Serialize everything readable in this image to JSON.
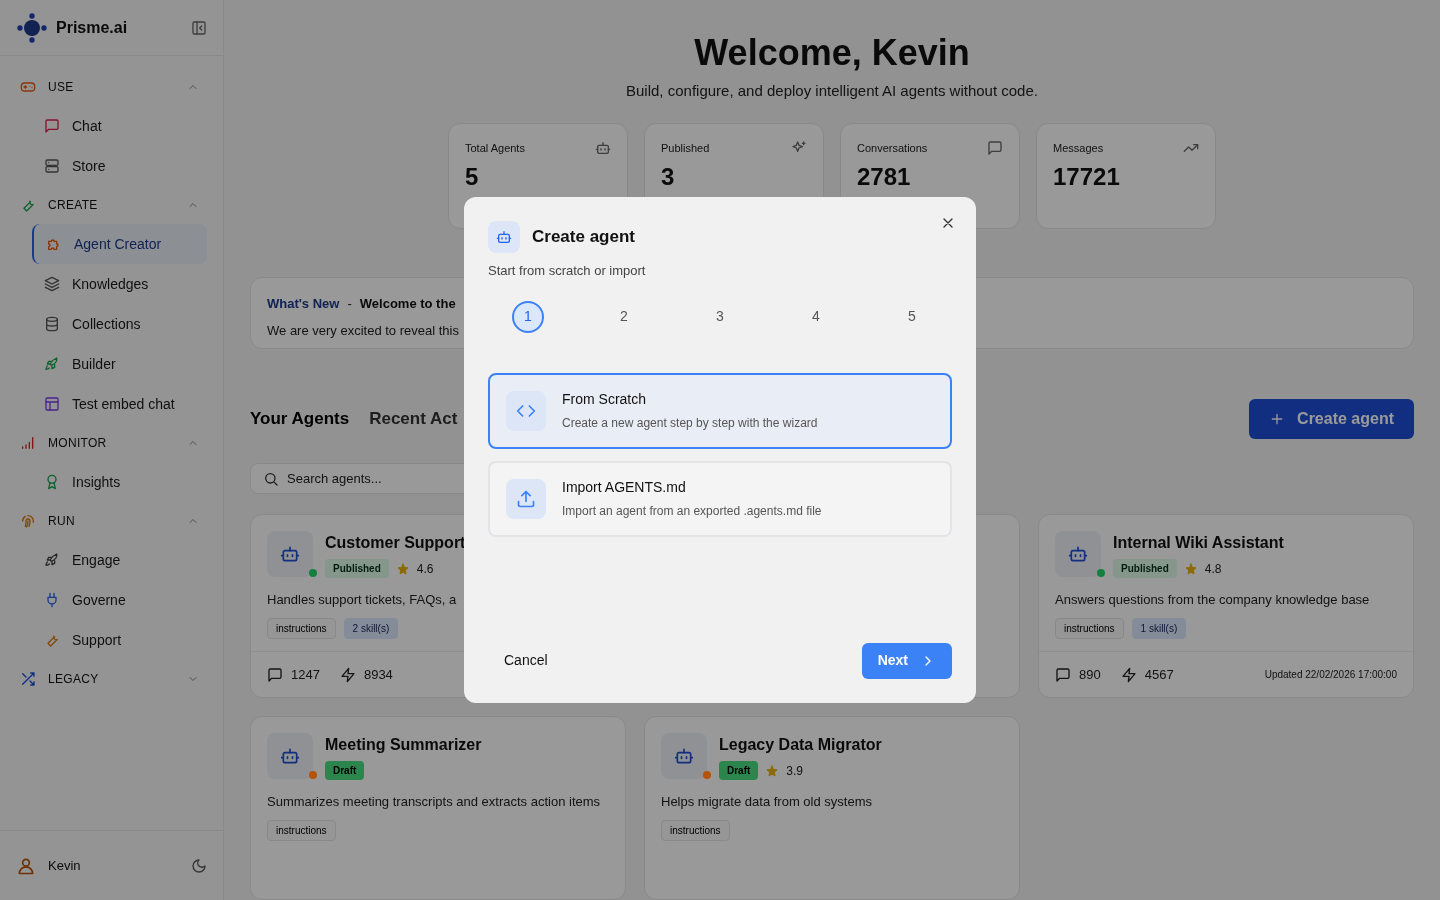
{
  "sidebar": {
    "brand": "Prisme.ai",
    "sections": [
      {
        "label": "USE",
        "expanded": true,
        "items": [
          {
            "label": "Chat",
            "selected": false
          },
          {
            "label": "Store",
            "selected": false
          }
        ]
      },
      {
        "label": "CREATE",
        "expanded": true,
        "items": [
          {
            "label": "Agent Creator",
            "selected": true
          },
          {
            "label": "Knowledges",
            "selected": false
          },
          {
            "label": "Collections",
            "selected": false
          },
          {
            "label": "Builder",
            "selected": false
          },
          {
            "label": "Test embed chat",
            "selected": false
          }
        ]
      },
      {
        "label": "MONITOR",
        "expanded": true,
        "items": [
          {
            "label": "Insights",
            "selected": false
          }
        ]
      },
      {
        "label": "RUN",
        "expanded": true,
        "items": [
          {
            "label": "Engage",
            "selected": false
          },
          {
            "label": "Governe",
            "selected": false
          },
          {
            "label": "Support",
            "selected": false
          }
        ]
      },
      {
        "label": "LEGACY",
        "expanded": false
      }
    ],
    "user": "Kevin"
  },
  "header": {
    "title": "Welcome, Kevin",
    "subtitle": "Build, configure, and deploy intelligent AI agents without code."
  },
  "stats": [
    {
      "label": "Total Agents",
      "value": "5"
    },
    {
      "label": "Published",
      "value": "3"
    },
    {
      "label": "Conversations",
      "value": "2781"
    },
    {
      "label": "Messages",
      "value": "17721"
    }
  ],
  "whats_new": {
    "label": "What's New",
    "separator": "-",
    "title": "Welcome to the",
    "text": "We are very excited to reveal this"
  },
  "tabs": [
    {
      "label": "Your Agents",
      "selected": true
    },
    {
      "label": "Recent Act",
      "selected": false
    }
  ],
  "create_button": "Create agent",
  "search": {
    "placeholder": "Search agents..."
  },
  "agents": [
    {
      "name": "Customer Support",
      "status": "Published",
      "color": "#15803d",
      "rating": "4.6",
      "description": "Handles support tickets, FAQs, a",
      "tags": [
        {
          "label": "instructions",
          "kind": "plain"
        },
        {
          "label": "2 skill(s)",
          "kind": "skill"
        }
      ],
      "conversations": "1247",
      "actions": "8934"
    },
    {
      "kind": "hidden"
    },
    {
      "name": "Internal Wiki Assistant",
      "status": "Published",
      "color": "#15803d",
      "rating": "4.8",
      "description": "Answers questions from the company knowledge base",
      "tags": [
        {
          "label": "instructions",
          "kind": "plain"
        },
        {
          "label": "1 skill(s)",
          "kind": "skill"
        }
      ],
      "conversations": "890",
      "actions": "4567",
      "updated": "Updated 22/02/2026 17:00:00"
    },
    {
      "name": "Meeting Summarizer",
      "status": "Draft",
      "color": "#b45309",
      "description": "Summarizes meeting transcripts and extracts action items",
      "tags": [
        {
          "label": "instructions",
          "kind": "plain"
        }
      ]
    },
    {
      "name": "Legacy Data Migrator",
      "status": "Draft",
      "color": "#b45309",
      "rating": "3.9",
      "description": "Helps migrate data from old systems",
      "tags": [
        {
          "label": "instructions",
          "kind": "plain"
        }
      ]
    }
  ],
  "modal": {
    "title": "Create agent",
    "subtitle": "Start from scratch or import",
    "steps": [
      {
        "label": "1",
        "selected": true
      },
      {
        "label": "2",
        "selected": false
      },
      {
        "label": "3",
        "selected": false
      },
      {
        "label": "4",
        "selected": false
      },
      {
        "label": "5",
        "selected": false
      }
    ],
    "options": [
      {
        "title": "From Scratch",
        "description": "Create a new agent step by step with the wizard",
        "selected": true
      },
      {
        "title": "Import AGENTS.md",
        "description": "Import an agent from an exported .agents.md file",
        "selected": false
      }
    ],
    "cancel": "Cancel",
    "next": "Next"
  }
}
